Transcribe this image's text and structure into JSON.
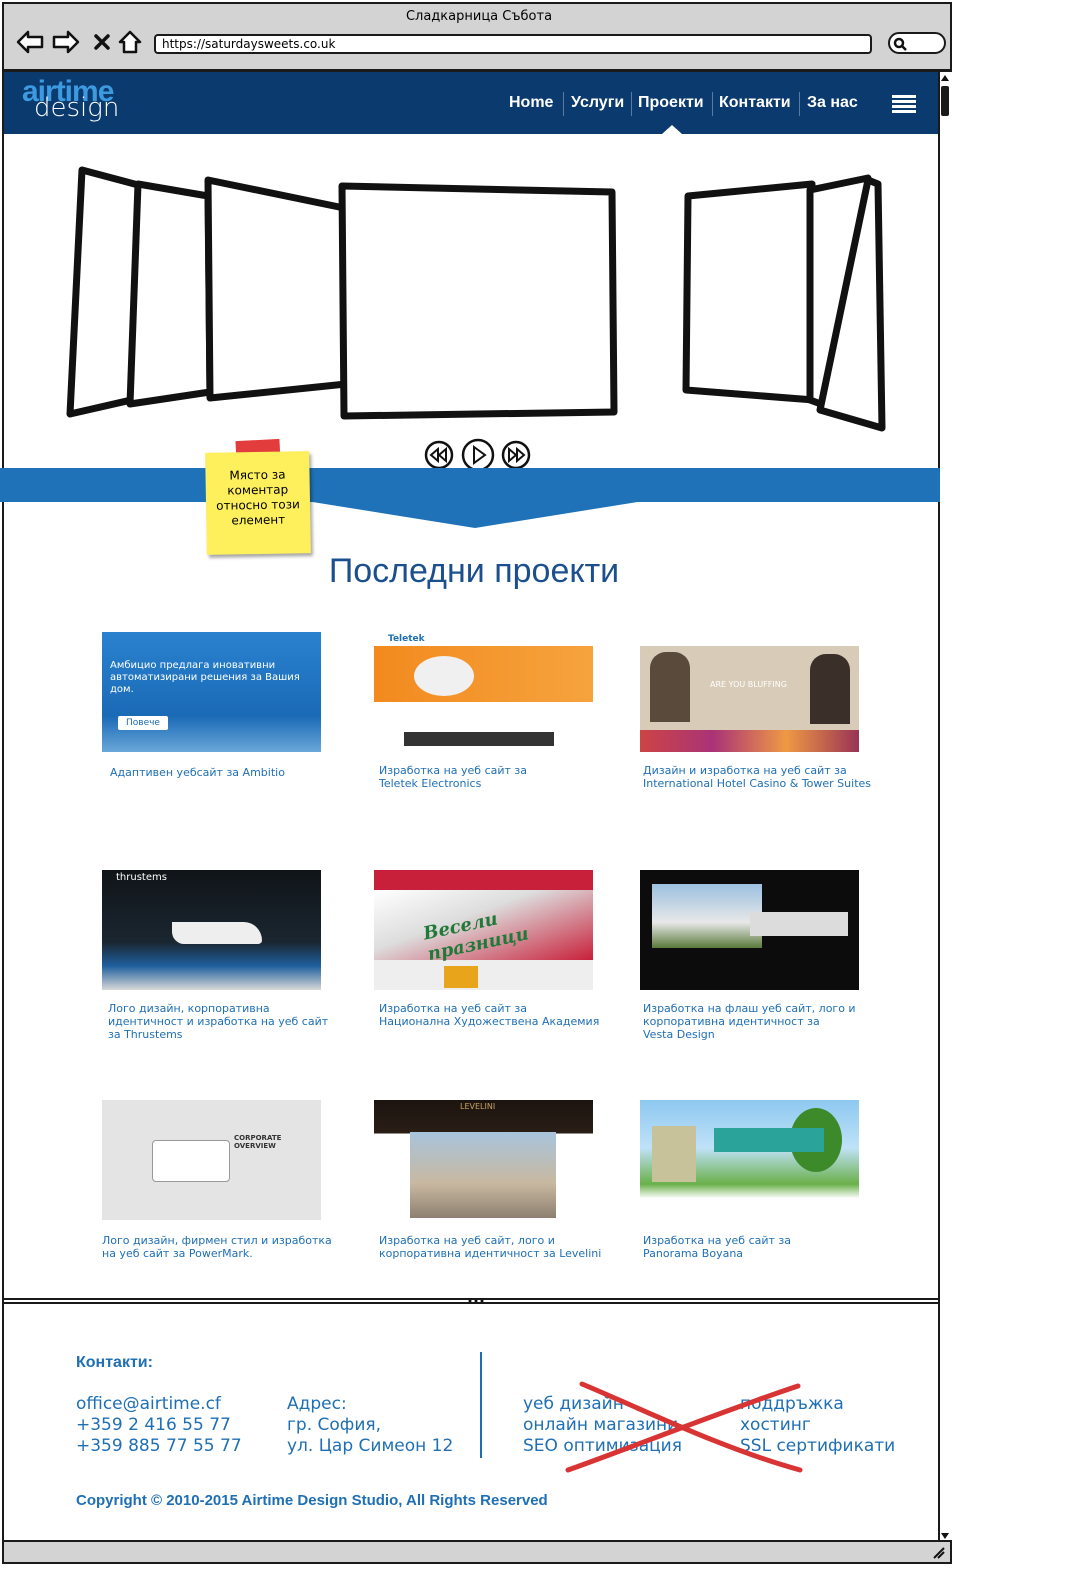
{
  "browser": {
    "window_title": "Сладкарница Събота",
    "url": "https://saturdaysweets.co.uk"
  },
  "site": {
    "logo_top": "airtime",
    "logo_bottom": "design",
    "nav": [
      "Home",
      "Услуги",
      "Проекти",
      "Контакти",
      "За нас"
    ],
    "active_nav": "Проекти"
  },
  "sticky_note": "Място за\nкоментар\nотносно този\nелемент",
  "section_title": "Последни проекти",
  "projects": [
    {
      "caption": "Адаптивен уебсайт за Ambitio",
      "thumb_text": "Амбицио предлага иновативни\nавтоматизирани решения за Вашия дом.",
      "thumb_button": "Повече",
      "theme": "ambitio"
    },
    {
      "caption": "Изработка на уеб сайт за\nTeletek Electronics",
      "thumb_text": "Teletek",
      "theme": "teletek"
    },
    {
      "caption": "Дизайн и изработка на уеб сайт за\nInternational Hotel Casino & Tower Suites",
      "thumb_text": "ARE YOU BLUFFING",
      "theme": "casino"
    },
    {
      "caption": "Лого дизайн, корпоративна\nидентичност и изработка на уеб сайт\nза Thrustems",
      "thumb_text": "thrustems",
      "theme": "thrustems"
    },
    {
      "caption": "Изработка на уеб сайт за\nНационална Художествена Академия",
      "thumb_text": "Весели празници",
      "theme": "nha"
    },
    {
      "caption": "Изработка на флаш уеб сайт, лого и\nкорпоративна идентичност за\nVesta Design",
      "theme": "vesta"
    },
    {
      "caption": "Лого дизайн, фирмен стил и изработка\nна уеб сайт за PowerMark.",
      "thumb_text": "CORPORATE\nOVERVIEW",
      "theme": "powermark"
    },
    {
      "caption": "Изработка на уеб сайт, лого и\nкорпоративна идентичност за Levelini",
      "thumb_text": "LEVELINI",
      "theme": "levelini"
    },
    {
      "caption": "Изработка на уеб сайт за\nPanorama Boyana",
      "theme": "panorama"
    }
  ],
  "footer": {
    "heading": "Контакти:",
    "contacts": "office@airtime.cf\n+359 2 416 55 77\n+359 885 77 55 77",
    "address": "Адрес:\nгр. София,\nул. Цар Симеон 12",
    "services_1": "уеб дизайн\nонлайн магазини\nSEO оптимизация",
    "services_2": "поддръжка\nхостинг\nSSL сертификати",
    "copyright": "Copyright © 2010-2015 Airtime Design Studio, All Rights Reserved"
  },
  "colors": {
    "header_bg": "#0b3a6e",
    "accent": "#1f72b8",
    "link": "#1f6fb5",
    "sticky": "#fdf05c",
    "cross": "#d93434"
  }
}
